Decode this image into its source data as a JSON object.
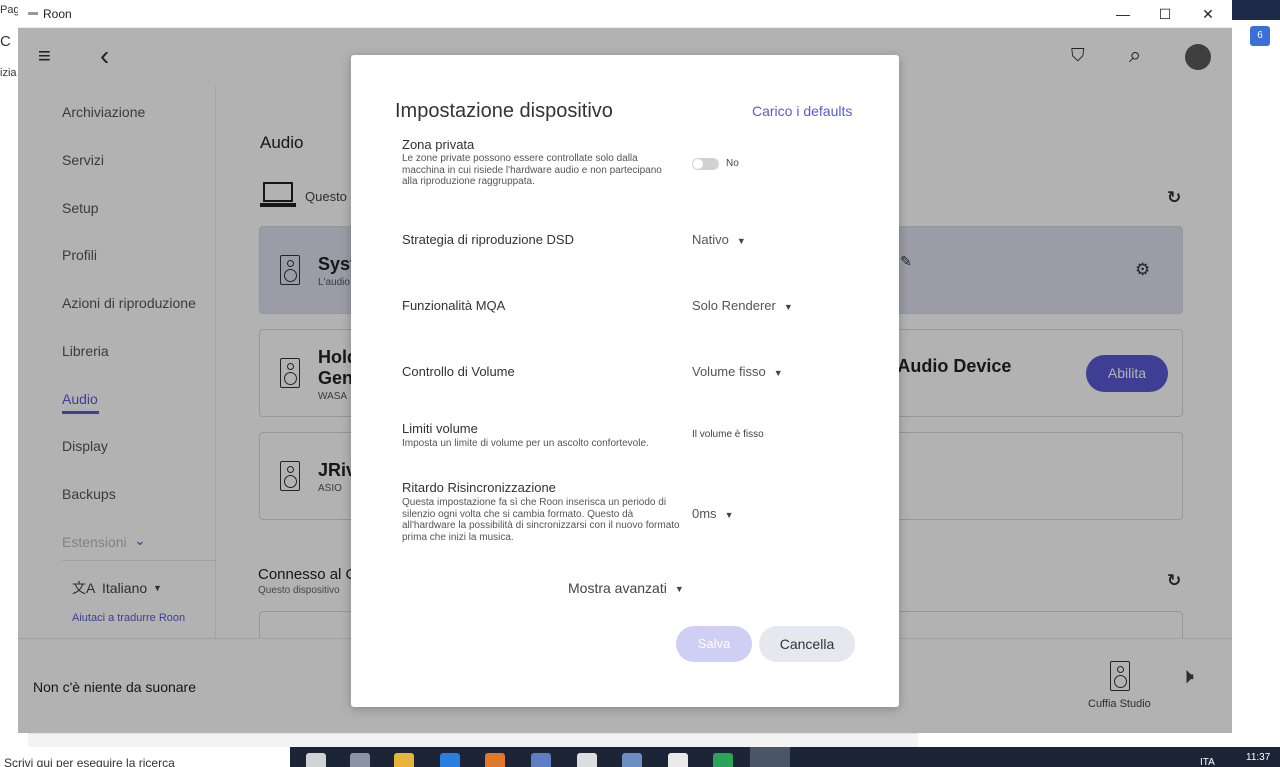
{
  "background": {
    "left_fragments": [
      "Pagi",
      "C",
      "izia"
    ],
    "right_badge": "6"
  },
  "window": {
    "title": "Roon",
    "minimize": "—",
    "maximize": "☐",
    "close": "✕"
  },
  "topbar": {
    "menu_icon": "≡",
    "back_icon": "‹",
    "bookmark_icon": "⛉",
    "search_icon": "⌕"
  },
  "sidebar": {
    "items": [
      {
        "label": "Archiviazione"
      },
      {
        "label": "Servizi"
      },
      {
        "label": "Setup"
      },
      {
        "label": "Profili"
      },
      {
        "label": "Azioni di riproduzione"
      },
      {
        "label": "Libreria"
      },
      {
        "label": "Audio"
      },
      {
        "label": "Display"
      },
      {
        "label": "Backups"
      },
      {
        "label": "Estensioni"
      }
    ],
    "language": "Italiano",
    "translate_help": "Aiutaci a tradurre Roon"
  },
  "content": {
    "heading": "Audio",
    "this_pc_label": "Questo",
    "devices": [
      {
        "name": "Syst",
        "sub": "L'audio"
      },
      {
        "name": "Hold",
        "name2": "Gen",
        "sub": "WASA",
        "right_label": "n Audio Device",
        "button": "Abilita"
      },
      {
        "name": "JRiv",
        "sub": "ASIO"
      }
    ],
    "connected_title": "Connesso al C",
    "connected_sub": "Questo dispositivo"
  },
  "player": {
    "status": "Non c'è niente da suonare",
    "zone_name": "Cuffia Studio"
  },
  "modal": {
    "title": "Impostazione dispositivo",
    "defaults_link": "Carico i defaults",
    "settings": [
      {
        "label": "Zona privata",
        "desc": "Le zone private possono essere controllate solo dalla macchina in cui risiede l'hardware audio e non partecipano alla riproduzione raggruppata.",
        "value": "No"
      },
      {
        "label": "Strategia di riproduzione DSD",
        "value": "Nativo"
      },
      {
        "label": "Funzionalità MQA",
        "value": "Solo Renderer"
      },
      {
        "label": "Controllo di Volume",
        "value": "Volume fisso"
      },
      {
        "label": "Limiti volume",
        "desc": "Imposta un limite di volume per un ascolto confortevole.",
        "value": "Il volume è fisso"
      },
      {
        "label": "Ritardo Risincronizzazione",
        "desc": "Questa impostazione fa sì che Roon inserisca un periodo di silenzio ogni volta che si cambia formato. Questo dà all'hardware la possibilità di sincronizzarsi con il nuovo formato prima che inizi la musica.",
        "value": "0ms"
      }
    ],
    "advanced": "Mostra avanzati",
    "save": "Salva",
    "cancel": "Cancella"
  },
  "taskbar": {
    "search_placeholder": "Scrivi qui per eseguire la ricerca",
    "time": "11:37",
    "tray_lang": "ITA"
  }
}
